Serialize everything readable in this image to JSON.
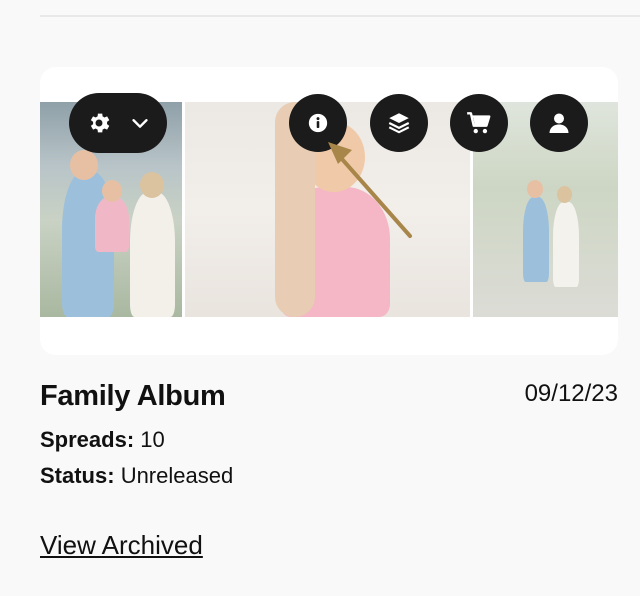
{
  "album": {
    "title": "Family Album",
    "date": "09/12/23",
    "spreads_label": "Spreads:",
    "spreads_value": "10",
    "status_label": "Status:",
    "status_value": "Unreleased"
  },
  "links": {
    "view_archived": "View Archived"
  },
  "toolbar": {
    "icons": [
      "gear-icon",
      "chevron-down-icon",
      "info-icon",
      "layers-icon",
      "cart-icon",
      "user-icon"
    ]
  },
  "colors": {
    "button_bg": "#1b1b1b",
    "arrow": "#a8864a",
    "card_bg": "#ffffff",
    "page_bg": "#f9f9f9"
  }
}
